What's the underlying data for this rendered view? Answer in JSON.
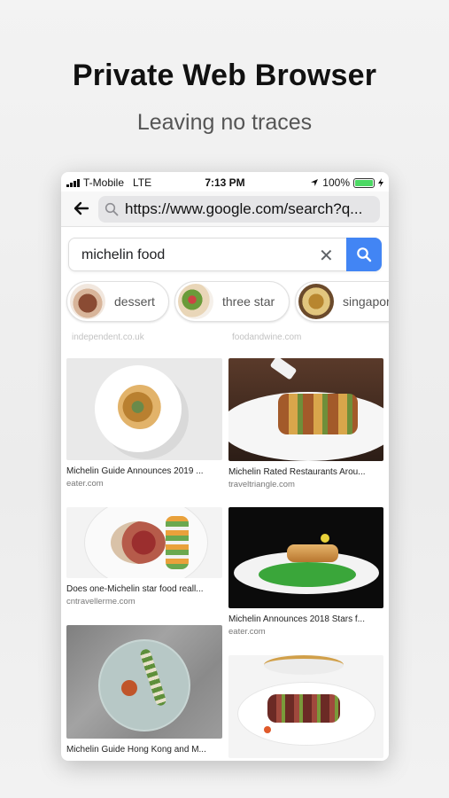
{
  "promo": {
    "headline": "Private Web Browser",
    "subline": "Leaving no traces"
  },
  "status_bar": {
    "carrier": "T-Mobile",
    "network": "LTE",
    "time": "7:13 PM",
    "battery": "100%",
    "battery_level": 1.0
  },
  "browser": {
    "url": "https://www.google.com/search?q..."
  },
  "search": {
    "query": "michelin food",
    "clear_symbol": "✕"
  },
  "chips": [
    {
      "label": "dessert"
    },
    {
      "label": "three star"
    },
    {
      "label": "singapore"
    }
  ],
  "faded_sources": [
    "independent.co.uk",
    "foodandwine.com"
  ],
  "results": {
    "left": [
      {
        "title": "Michelin Guide Announces 2019 ...",
        "source": "eater.com"
      },
      {
        "title": "Does one-Michelin star food reall...",
        "source": "cntravellerme.com"
      },
      {
        "title": "Michelin Guide Hong Kong and M...",
        "source": ""
      }
    ],
    "right": [
      {
        "title": "Michelin Rated Restaurants Arou...",
        "source": "traveltriangle.com"
      },
      {
        "title": "Michelin Announces 2018 Stars f...",
        "source": "eater.com"
      },
      {
        "title": "",
        "source": ""
      }
    ]
  },
  "colors": {
    "search_button": "#4285f4",
    "battery": "#4cd964"
  }
}
